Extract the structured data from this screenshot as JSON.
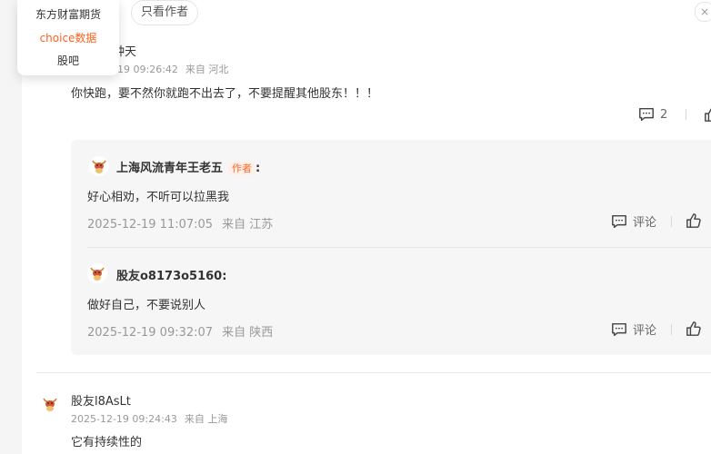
{
  "dropdown": {
    "items": [
      "东方财富期货",
      "choice数据",
      "股吧"
    ],
    "active_color": "#ff5f1f"
  },
  "filter": {
    "only_author": "只看作者"
  },
  "comment1": {
    "name_partial": "钟天",
    "time_partial": "19 09:26:42",
    "location": "来自 河北",
    "text": "你快跑，要不然你就跑不出去了，不要提醒其他股东！！！",
    "reply_count": "2"
  },
  "replies": [
    {
      "name": "上海风流青年王老五",
      "author_tag": "作者",
      "colon": ":",
      "text": "好心相劝，不听可以拉黑我",
      "time": "2025-12-19 11:07:05",
      "location": "来自 江苏",
      "comment_label": "评论"
    },
    {
      "name": "股友o8173o5160",
      "colon": ":",
      "text": "做好自己，不要说别人",
      "time": "2025-12-19 09:32:07",
      "location": "来自 陕西",
      "comment_label": "评论"
    }
  ],
  "comment2": {
    "name": "股友l8AsLt",
    "time": "2025-12-19 09:24:43",
    "location": "来自 上海",
    "text": "它有持续性的"
  },
  "icons": {
    "comment": "comment-icon",
    "like": "thumb-up-icon",
    "avatar": "bull-avatar-icon"
  }
}
